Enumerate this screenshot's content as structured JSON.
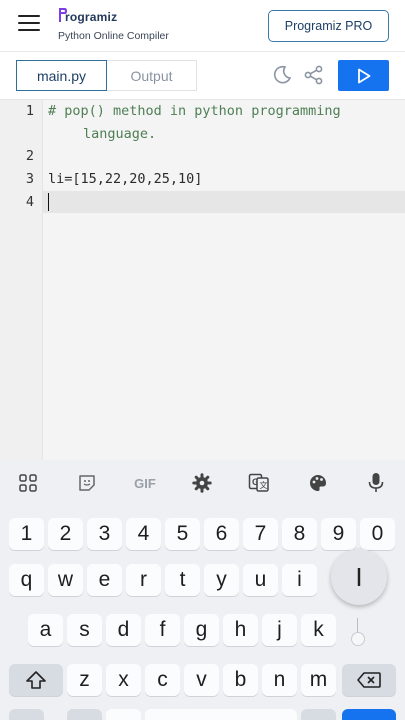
{
  "header": {
    "logo_text": "rogramiz",
    "subtitle": "Python Online Compiler",
    "pro_button": "Programiz PRO"
  },
  "toolbar": {
    "tab_main": "main.py",
    "tab_output": "Output",
    "icons": [
      "moon-icon",
      "share-icon",
      "run-play-icon"
    ]
  },
  "editor": {
    "line_numbers": [
      "1",
      "2",
      "3",
      "4"
    ],
    "line1_a": "# pop() method in python programming",
    "line1_b": "language.",
    "line3": "li=[15,22,20,25,10]"
  },
  "keyboard": {
    "toolbar_icons": [
      "apps-grid-icon",
      "sticker-icon",
      "gif-icon",
      "settings-gear-icon",
      "translate-icon",
      "palette-icon",
      "microphone-icon"
    ],
    "gif_label": "GIF",
    "row_numbers": [
      "1",
      "2",
      "3",
      "4",
      "5",
      "6",
      "7",
      "8",
      "9",
      "0"
    ],
    "row_q": [
      "q",
      "w",
      "e",
      "r",
      "t",
      "y",
      "u",
      "i"
    ],
    "row_a": [
      "a",
      "s",
      "d",
      "f",
      "g",
      "h",
      "j",
      "k"
    ],
    "row_z": [
      "z",
      "x",
      "c",
      "v",
      "b",
      "n",
      "m"
    ],
    "cursor_glyph": "I"
  },
  "colors": {
    "run_button": "#1673ef",
    "accent_border": "#2f6f9a",
    "comment_green": "#4e7f55"
  }
}
